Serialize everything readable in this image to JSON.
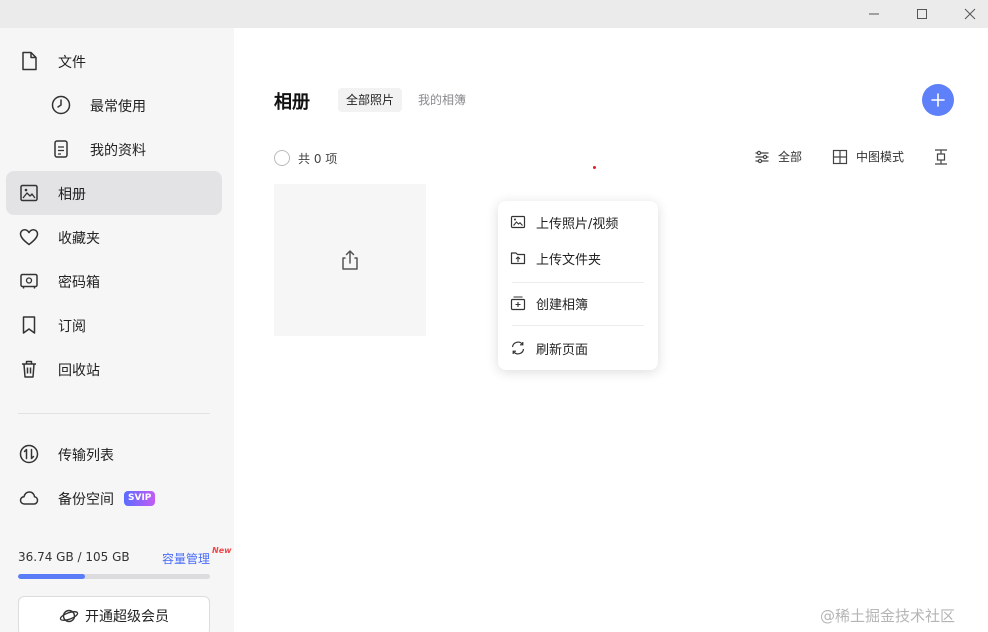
{
  "window": {
    "minimize": "minimize",
    "maximize": "maximize",
    "close": "close"
  },
  "sidebar": {
    "items": [
      {
        "label": "文件",
        "icon": "file-icon"
      },
      {
        "label": "最常使用",
        "icon": "clock-icon"
      },
      {
        "label": "我的资料",
        "icon": "document-icon"
      },
      {
        "label": "相册",
        "icon": "photo-icon"
      },
      {
        "label": "收藏夹",
        "icon": "heart-icon"
      },
      {
        "label": "密码箱",
        "icon": "safe-icon"
      },
      {
        "label": "订阅",
        "icon": "bookmark-icon"
      },
      {
        "label": "回收站",
        "icon": "trash-icon"
      },
      {
        "label": "传输列表",
        "icon": "transfer-icon"
      },
      {
        "label": "备份空间",
        "icon": "cloud-icon"
      }
    ],
    "svip_badge": "SVIP",
    "storage": {
      "text": "36.74 GB / 105 GB",
      "used_fraction": 0.35,
      "manage": "容量管理",
      "new_badge": "New"
    },
    "vip_button": "开通超级会员"
  },
  "main": {
    "title": "相册",
    "tabs": [
      {
        "label": "全部照片",
        "active": true
      },
      {
        "label": "我的相簿",
        "active": false
      }
    ],
    "count": "共 0 项",
    "filter": "全部",
    "view_mode": "中图模式"
  },
  "menu": {
    "items": [
      {
        "label": "上传照片/视频",
        "icon": "photo-upload-icon"
      },
      {
        "label": "上传文件夹",
        "icon": "folder-upload-icon"
      },
      {
        "label": "创建相簿",
        "icon": "album-add-icon"
      },
      {
        "label": "刷新页面",
        "icon": "refresh-icon"
      }
    ]
  },
  "watermark": "@稀土掘金技术社区",
  "colors": {
    "accent": "#5e80f8",
    "sidebar_bg": "#f6f6f7",
    "active_bg": "#e3e3e5"
  }
}
